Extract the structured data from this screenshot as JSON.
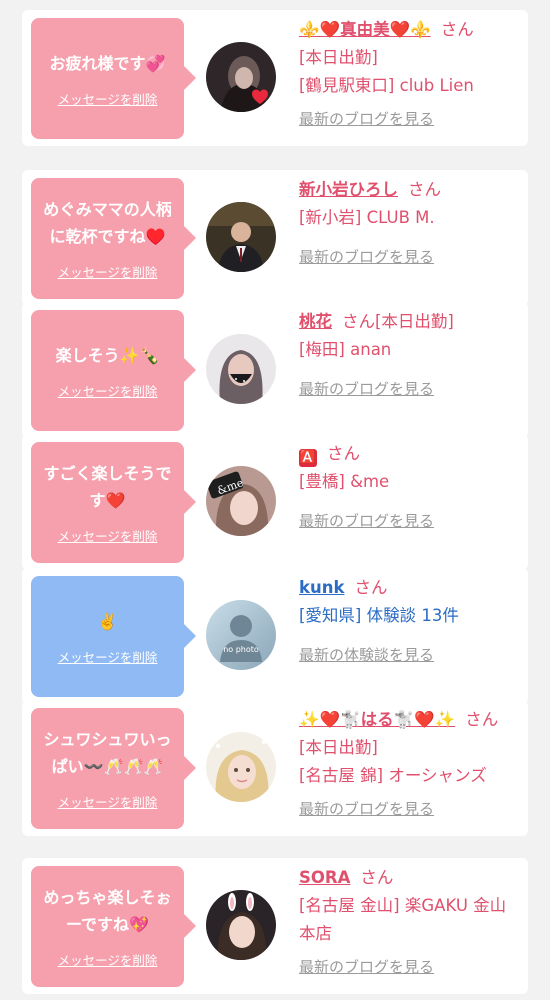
{
  "delete_label": "メッセージを削除",
  "san_label": "さん",
  "cards": [
    {
      "message": "お疲れ様です💞",
      "bubble_color": "pink",
      "avatar": "avatar-dark-hair-heart",
      "name": "⚜️❤️真由美❤️⚜️",
      "name_suffix": "",
      "status": "[本日出勤]",
      "location": "[鶴見駅東口] club Lien",
      "link": "最新のブログを見る"
    },
    {
      "message": "めぐみママの人柄\nに乾杯ですね♥️",
      "bubble_color": "pink",
      "avatar": "avatar-man-suit",
      "name": "新小岩ひろし",
      "name_suffix": "",
      "status": "",
      "location": "[新小岩] CLUB M.",
      "link": "最新のブログを見る"
    },
    {
      "message": "楽しそう✨🍾",
      "bubble_color": "pink",
      "avatar": "avatar-woman-mask",
      "name": "桃花",
      "name_suffix": "[本日出勤]",
      "status": "",
      "location": "[梅田] anan",
      "link": "最新のブログを見る"
    },
    {
      "message": "すごく楽しそうで\nす❤️",
      "bubble_color": "pink",
      "avatar": "avatar-andme-logo",
      "name": "🅰️",
      "name_suffix": "",
      "status": "",
      "location": "[豊橋] &me",
      "link": "最新のブログを見る"
    },
    {
      "message": "✌️",
      "bubble_color": "blue",
      "avatar": "avatar-no-photo",
      "name": "kunk",
      "name_suffix": "",
      "status": "",
      "location": "[愛知県] 体験談 13件",
      "link": "最新の体験談を見る"
    },
    {
      "message": "シュワシュワいっ\nぱい〰️🥂🥂🥂",
      "bubble_color": "pink",
      "avatar": "avatar-blonde-woman",
      "name": "✨❤️🐩はる🐩❤️✨",
      "name_suffix": "",
      "status": "[本日出勤]",
      "location": "[名古屋 錦] オーシャンズ",
      "link": "最新のブログを見る"
    },
    {
      "message": "めっちゃ楽しそぉ\nーですね💖",
      "bubble_color": "pink",
      "avatar": "avatar-bunny-filter",
      "name": "SORA",
      "name_suffix": "",
      "status": "",
      "location": "[名古屋 金山] 楽GAKU 金山本店",
      "link": "最新のブログを見る"
    }
  ],
  "colors": {
    "background": "#f2f2f2",
    "card": "#ffffff",
    "bubble_pink": "#f6a0ad",
    "bubble_blue": "#8fbaf3",
    "name_pink": "#e0506d",
    "name_blue": "#2b6cc4",
    "link_gray": "#9a9a9a"
  }
}
